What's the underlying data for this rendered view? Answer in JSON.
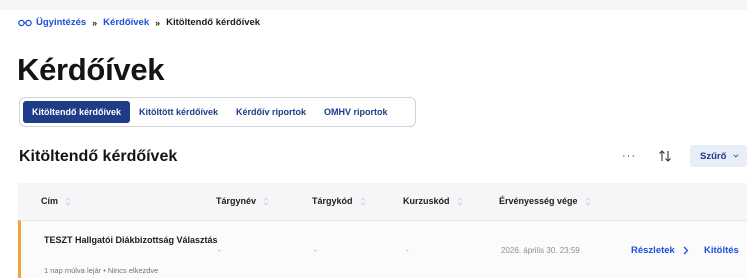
{
  "breadcrumb": {
    "home_icon": "glasses-icon",
    "items": [
      "Ügyintézés",
      "Kérdőívek",
      "Kitöltendő kérdőívek"
    ],
    "separator": "»"
  },
  "page": {
    "title": "Kérdőívek"
  },
  "tabs": [
    {
      "label": "Kitöltendő kérdőívek",
      "active": true
    },
    {
      "label": "Kitöltött kérdőívek",
      "active": false
    },
    {
      "label": "Kérdőív riportok",
      "active": false
    },
    {
      "label": "OMHV riportok",
      "active": false
    }
  ],
  "section": {
    "title": "Kitöltendő kérdőívek"
  },
  "toolbar": {
    "more_label": "···",
    "sort_icon": "sort-arrows-icon",
    "filter_label": "Szűrő",
    "filter_icon": "chevron-down-icon"
  },
  "table": {
    "columns": [
      "Cím",
      "Tárgynév",
      "Tárgykód",
      "Kurzuskód",
      "Érvényesség vége"
    ],
    "rows": [
      {
        "title": "TESZT Hallgatói Diákbizottság Választás",
        "meta": "1 nap múlva lejár • Nincs elkezdve",
        "subject_name": "-",
        "subject_code": "-",
        "course_code": "-",
        "valid_until": "2026. április 30. 23:59",
        "details_label": "Részletek",
        "fill_label": "Kitöltés"
      }
    ]
  },
  "colors": {
    "accent": "#1f3c88",
    "link": "#1d4ed8",
    "row_marker": "#f0a33a"
  }
}
